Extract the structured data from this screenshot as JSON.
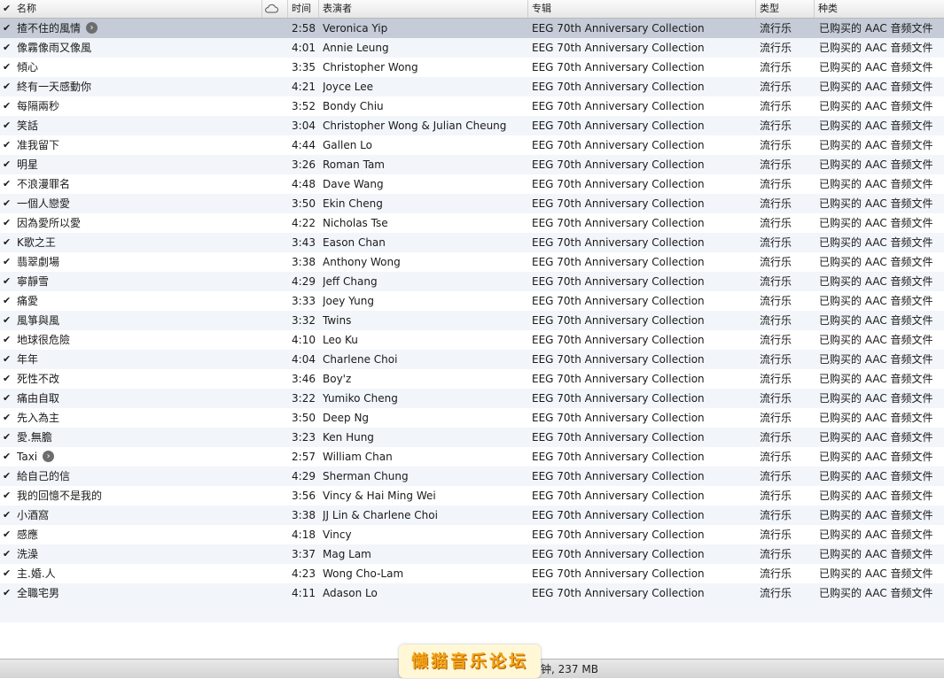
{
  "header": {
    "check": "✔",
    "name": "名称",
    "time": "时间",
    "artist": "表演者",
    "album": "专辑",
    "genre": "类型",
    "kind": "种类"
  },
  "tracks": [
    {
      "name": "揸不住的風情",
      "time": "2:58",
      "artist": "Veronica Yip",
      "album": "EEG 70th Anniversary Collection",
      "genre": "流行乐",
      "kind": "已购买的 AAC 音频文件",
      "selected": true,
      "arrow": true
    },
    {
      "name": "像霧像雨又像風",
      "time": "4:01",
      "artist": "Annie Leung",
      "album": "EEG 70th Anniversary Collection",
      "genre": "流行乐",
      "kind": "已购买的 AAC 音频文件"
    },
    {
      "name": "傾心",
      "time": "3:35",
      "artist": "Christopher Wong",
      "album": "EEG 70th Anniversary Collection",
      "genre": "流行乐",
      "kind": "已购买的 AAC 音频文件"
    },
    {
      "name": "終有一天感動你",
      "time": "4:21",
      "artist": "Joyce Lee",
      "album": "EEG 70th Anniversary Collection",
      "genre": "流行乐",
      "kind": "已购买的 AAC 音频文件"
    },
    {
      "name": "每隔兩秒",
      "time": "3:52",
      "artist": "Bondy Chiu",
      "album": "EEG 70th Anniversary Collection",
      "genre": "流行乐",
      "kind": "已购买的 AAC 音频文件"
    },
    {
      "name": "笑話",
      "time": "3:04",
      "artist": "Christopher Wong & Julian Cheung",
      "album": "EEG 70th Anniversary Collection",
      "genre": "流行乐",
      "kind": "已购买的 AAC 音频文件"
    },
    {
      "name": "准我留下",
      "time": "4:44",
      "artist": "Gallen Lo",
      "album": "EEG 70th Anniversary Collection",
      "genre": "流行乐",
      "kind": "已购买的 AAC 音频文件"
    },
    {
      "name": "明星",
      "time": "3:26",
      "artist": "Roman Tam",
      "album": "EEG 70th Anniversary Collection",
      "genre": "流行乐",
      "kind": "已购买的 AAC 音频文件"
    },
    {
      "name": "不浪漫罪名",
      "time": "4:48",
      "artist": "Dave Wang",
      "album": "EEG 70th Anniversary Collection",
      "genre": "流行乐",
      "kind": "已购买的 AAC 音频文件"
    },
    {
      "name": "一個人戀愛",
      "time": "3:50",
      "artist": "Ekin Cheng",
      "album": "EEG 70th Anniversary Collection",
      "genre": "流行乐",
      "kind": "已购买的 AAC 音频文件"
    },
    {
      "name": "因為愛所以愛",
      "time": "4:22",
      "artist": "Nicholas Tse",
      "album": "EEG 70th Anniversary Collection",
      "genre": "流行乐",
      "kind": "已购买的 AAC 音频文件"
    },
    {
      "name": "K歌之王",
      "time": "3:43",
      "artist": "Eason Chan",
      "album": "EEG 70th Anniversary Collection",
      "genre": "流行乐",
      "kind": "已购买的 AAC 音频文件"
    },
    {
      "name": "翡翠劇場",
      "time": "3:38",
      "artist": "Anthony Wong",
      "album": "EEG 70th Anniversary Collection",
      "genre": "流行乐",
      "kind": "已购买的 AAC 音频文件"
    },
    {
      "name": "寧靜雪",
      "time": "4:29",
      "artist": "Jeff Chang",
      "album": "EEG 70th Anniversary Collection",
      "genre": "流行乐",
      "kind": "已购买的 AAC 音频文件"
    },
    {
      "name": "痛愛",
      "time": "3:33",
      "artist": "Joey Yung",
      "album": "EEG 70th Anniversary Collection",
      "genre": "流行乐",
      "kind": "已购买的 AAC 音频文件"
    },
    {
      "name": "風箏與風",
      "time": "3:32",
      "artist": "Twins",
      "album": "EEG 70th Anniversary Collection",
      "genre": "流行乐",
      "kind": "已购买的 AAC 音频文件"
    },
    {
      "name": "地球很危險",
      "time": "4:10",
      "artist": "Leo Ku",
      "album": "EEG 70th Anniversary Collection",
      "genre": "流行乐",
      "kind": "已购买的 AAC 音频文件"
    },
    {
      "name": "年年",
      "time": "4:04",
      "artist": "Charlene Choi",
      "album": "EEG 70th Anniversary Collection",
      "genre": "流行乐",
      "kind": "已购买的 AAC 音频文件"
    },
    {
      "name": "死性不改",
      "time": "3:46",
      "artist": "Boy'z",
      "album": "EEG 70th Anniversary Collection",
      "genre": "流行乐",
      "kind": "已购买的 AAC 音频文件"
    },
    {
      "name": "痛由自取",
      "time": "3:22",
      "artist": "Yumiko Cheng",
      "album": "EEG 70th Anniversary Collection",
      "genre": "流行乐",
      "kind": "已购买的 AAC 音频文件"
    },
    {
      "name": "先入為主",
      "time": "3:50",
      "artist": "Deep Ng",
      "album": "EEG 70th Anniversary Collection",
      "genre": "流行乐",
      "kind": "已购买的 AAC 音频文件"
    },
    {
      "name": "愛.無膽",
      "time": "3:23",
      "artist": "Ken Hung",
      "album": "EEG 70th Anniversary Collection",
      "genre": "流行乐",
      "kind": "已购买的 AAC 音频文件"
    },
    {
      "name": "Taxi",
      "time": "2:57",
      "artist": "William Chan",
      "album": "EEG 70th Anniversary Collection",
      "genre": "流行乐",
      "kind": "已购买的 AAC 音频文件",
      "arrow": true
    },
    {
      "name": "給自己的信",
      "time": "4:29",
      "artist": "Sherman Chung",
      "album": "EEG 70th Anniversary Collection",
      "genre": "流行乐",
      "kind": "已购买的 AAC 音频文件"
    },
    {
      "name": "我的回憶不是我的",
      "time": "3:56",
      "artist": "Vincy & Hai Ming Wei",
      "album": "EEG 70th Anniversary Collection",
      "genre": "流行乐",
      "kind": "已购买的 AAC 音频文件"
    },
    {
      "name": "小酒窩",
      "time": "3:38",
      "artist": "JJ Lin & Charlene Choi",
      "album": "EEG 70th Anniversary Collection",
      "genre": "流行乐",
      "kind": "已购买的 AAC 音频文件"
    },
    {
      "name": "感應",
      "time": "4:18",
      "artist": "Vincy",
      "album": "EEG 70th Anniversary Collection",
      "genre": "流行乐",
      "kind": "已购买的 AAC 音频文件"
    },
    {
      "name": "洗澡",
      "time": "3:37",
      "artist": "Mag Lam",
      "album": "EEG 70th Anniversary Collection",
      "genre": "流行乐",
      "kind": "已购买的 AAC 音频文件"
    },
    {
      "name": "主.婚.人",
      "time": "4:23",
      "artist": "Wong Cho-Lam",
      "album": "EEG 70th Anniversary Collection",
      "genre": "流行乐",
      "kind": "已购买的 AAC 音频文件"
    },
    {
      "name": "全職宅男",
      "time": "4:11",
      "artist": "Adason Lo",
      "album": "EEG 70th Anniversary Collection",
      "genre": "流行乐",
      "kind": "已购买的 AAC 音频文件"
    }
  ],
  "status": {
    "text": "钟, 237 MB"
  },
  "watermark": {
    "text": "懒猫音乐论坛"
  },
  "icons": {
    "check": "check-icon",
    "arrow": "arrow-right-circle-icon",
    "cloud": "cloud-icon"
  }
}
